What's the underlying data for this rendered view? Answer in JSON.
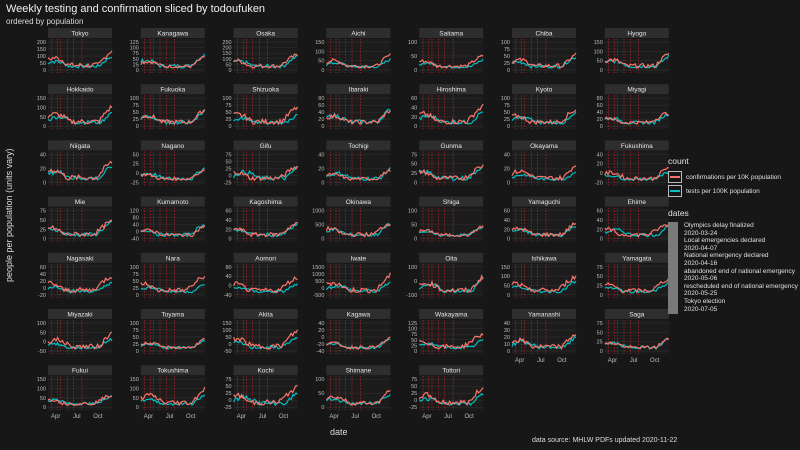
{
  "title": "Weekly testing and confirmation sliced by todoufuken",
  "subtitle": "ordered by population",
  "y_axis_label": "people per population (units vary)",
  "x_axis_label": "date",
  "source": "data source: MHLW PDFs updated  2020-11-22",
  "colors": {
    "confirmations": "#f8766d",
    "tests": "#00bfc4",
    "event_line": "#ff2a2a",
    "panel_bg": "#1c1c1c",
    "strip_bg": "#2e2e2e"
  },
  "legend_count": {
    "title": "count",
    "items": [
      {
        "label": "confirmations per 10K population",
        "color": "#f8766d"
      },
      {
        "label": "tests per 100K population",
        "color": "#00bfc4"
      }
    ]
  },
  "legend_dates": {
    "title": "dates",
    "entries": [
      "Olympics delay finalized",
      "2020-03-24",
      "Local emergencies declared",
      "2020-04-07",
      "National emergency declared",
      "2020-04-16",
      "abandoned end of national emergency",
      "2020-05-06",
      "rescheduled end of national emergency",
      "2020-05-25",
      "Tokyo election",
      "2020-07-05"
    ]
  },
  "chart_data": {
    "type": "line",
    "x_ticks": [
      "Apr",
      "Jul",
      "Oct"
    ],
    "panels": [
      {
        "name": "Tokyo",
        "yticks": [
          "200",
          "150",
          "100",
          "50",
          "0"
        ]
      },
      {
        "name": "Kanagawa",
        "yticks": [
          "125",
          "100",
          "75",
          "50",
          "25",
          "0"
        ]
      },
      {
        "name": "Osaka",
        "yticks": [
          "250",
          "200",
          "150",
          "100",
          "50",
          "0"
        ]
      },
      {
        "name": "Aichi",
        "yticks": [
          "150",
          "100",
          "50",
          "0"
        ]
      },
      {
        "name": "Saitama",
        "yticks": [
          "100",
          "50",
          "0"
        ]
      },
      {
        "name": "Chiba",
        "yticks": [
          "100",
          "75",
          "50",
          "25",
          "0"
        ]
      },
      {
        "name": "Hyogo",
        "yticks": [
          "150",
          "100",
          "50",
          "0"
        ]
      },
      {
        "name": "Hokkaido",
        "yticks": [
          "150",
          "100",
          "50",
          "0"
        ]
      },
      {
        "name": "Fukuoka",
        "yticks": [
          "100",
          "75",
          "50",
          "25",
          "0"
        ]
      },
      {
        "name": "Shizuoka",
        "yticks": [
          "100",
          "75",
          "50",
          "25",
          "0"
        ]
      },
      {
        "name": "Ibaraki",
        "yticks": [
          "80",
          "60",
          "40",
          "20",
          "0"
        ]
      },
      {
        "name": "Hiroshima",
        "yticks": [
          "60",
          "40",
          "20",
          "0"
        ]
      },
      {
        "name": "Kyoto",
        "yticks": [
          "100",
          "75",
          "50",
          "25",
          "0"
        ]
      },
      {
        "name": "Miyagi",
        "yticks": [
          "80",
          "60",
          "40",
          "20",
          "0"
        ]
      },
      {
        "name": "Niigata",
        "yticks": [
          "40",
          "20",
          "0"
        ]
      },
      {
        "name": "Nagano",
        "yticks": [
          "50",
          "25",
          "0",
          "-25"
        ]
      },
      {
        "name": "Gifu",
        "yticks": [
          "75",
          "50",
          "25",
          "0",
          "-25"
        ]
      },
      {
        "name": "Tochigi",
        "yticks": [
          "40",
          "20",
          "0"
        ]
      },
      {
        "name": "Gunma",
        "yticks": [
          "75",
          "50",
          "25",
          "0"
        ]
      },
      {
        "name": "Okayama",
        "yticks": [
          "40",
          "20",
          "0"
        ]
      },
      {
        "name": "Fukushima",
        "yticks": [
          "40",
          "20",
          "0",
          "-20"
        ]
      },
      {
        "name": "Mie",
        "yticks": [
          "75",
          "50",
          "25",
          "0"
        ]
      },
      {
        "name": "Kumamoto",
        "yticks": [
          "120",
          "80",
          "40",
          "0",
          "-40"
        ]
      },
      {
        "name": "Kagoshima",
        "yticks": [
          "60",
          "40",
          "20",
          "0"
        ]
      },
      {
        "name": "Okinawa",
        "yticks": [
          "1000",
          "500",
          "0"
        ]
      },
      {
        "name": "Shiga",
        "yticks": [
          "100",
          "50",
          "0"
        ]
      },
      {
        "name": "Yamaguchi",
        "yticks": [
          "60",
          "40",
          "20",
          "0"
        ]
      },
      {
        "name": "Ehime",
        "yticks": [
          "60",
          "40",
          "20",
          "0"
        ]
      },
      {
        "name": "Nagasaki",
        "yticks": [
          "60",
          "40",
          "20",
          "0",
          "-20"
        ]
      },
      {
        "name": "Nara",
        "yticks": [
          "100",
          "75",
          "50",
          "25",
          "0"
        ]
      },
      {
        "name": "Aomori",
        "yticks": [
          "80",
          "40",
          "0",
          "-40"
        ]
      },
      {
        "name": "Iwate",
        "yticks": [
          "1500",
          "1000",
          "500",
          "0",
          "-500"
        ]
      },
      {
        "name": "Oita",
        "yticks": [
          "100",
          "0",
          "-100"
        ]
      },
      {
        "name": "Ishikawa",
        "yticks": [
          "150",
          "100",
          "50",
          "0"
        ]
      },
      {
        "name": "Yamagata",
        "yticks": [
          "75",
          "50",
          "25",
          "0"
        ]
      },
      {
        "name": "Miyazaki",
        "yticks": [
          "100",
          "50",
          "0",
          "-50"
        ]
      },
      {
        "name": "Toyama",
        "yticks": [
          "100",
          "75",
          "50",
          "25",
          "0"
        ]
      },
      {
        "name": "Akita",
        "yticks": [
          "150",
          "100",
          "50",
          "0",
          "-50"
        ]
      },
      {
        "name": "Kagawa",
        "yticks": [
          "40",
          "20",
          "0",
          "-20",
          "-40"
        ]
      },
      {
        "name": "Wakayama",
        "yticks": [
          "125",
          "100",
          "75",
          "50",
          "25",
          "0"
        ]
      },
      {
        "name": "Yamanashi",
        "yticks": [
          "40",
          "30",
          "20",
          "10",
          "0"
        ]
      },
      {
        "name": "Saga",
        "yticks": [
          "75",
          "50",
          "25",
          "0"
        ]
      },
      {
        "name": "Fukui",
        "yticks": [
          "150",
          "100",
          "50",
          "0"
        ]
      },
      {
        "name": "Tokushima",
        "yticks": [
          "150",
          "100",
          "50",
          "0"
        ]
      },
      {
        "name": "Kochi",
        "yticks": [
          "75",
          "50",
          "25",
          "0",
          "-25"
        ]
      },
      {
        "name": "Shimane",
        "yticks": [
          "100",
          "50",
          "0"
        ]
      },
      {
        "name": "Tottori",
        "yticks": [
          "75",
          "50",
          "25",
          "0",
          "-25"
        ]
      }
    ]
  }
}
